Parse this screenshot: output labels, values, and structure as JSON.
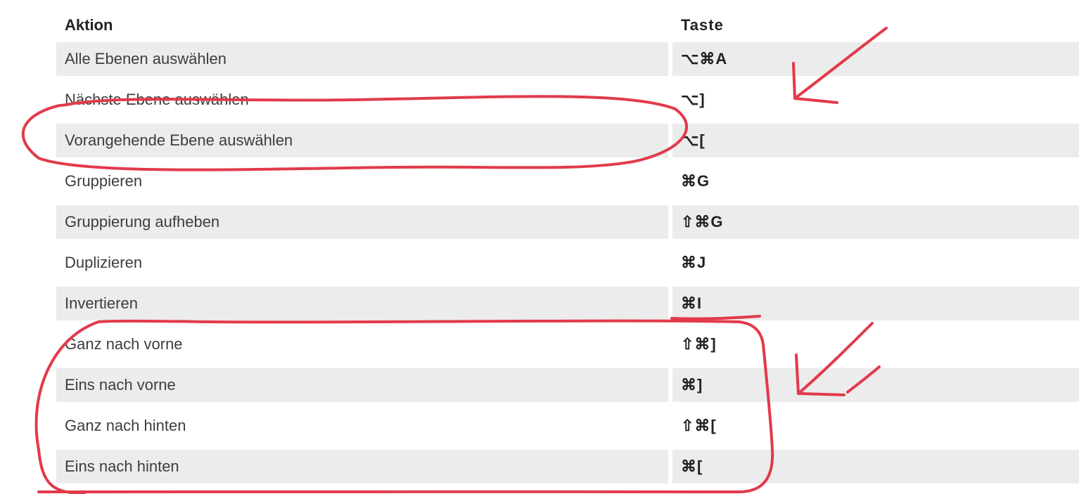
{
  "glyphs": {
    "cmd": "⌘",
    "opt": "⌥",
    "shift": "⇧"
  },
  "headers": {
    "action": "Aktion",
    "key": "Taste"
  },
  "rows": [
    {
      "action": "Alle Ebenen auswählen",
      "key": "⌥⌘A",
      "shade": true
    },
    {
      "action": "Nächste Ebene auswählen",
      "key": "⌥]",
      "shade": false
    },
    {
      "action": "Vorangehende Ebene auswählen",
      "key": "⌥[",
      "shade": true
    },
    {
      "action": "Gruppieren",
      "key": "⌘G",
      "shade": false
    },
    {
      "action": "Gruppierung aufheben",
      "key": "⇧⌘G",
      "shade": true
    },
    {
      "action": "Duplizieren",
      "key": "⌘J",
      "shade": false
    },
    {
      "action": "Invertieren",
      "key": "⌘I",
      "shade": true
    },
    {
      "action": "Ganz nach vorne",
      "key": "⇧⌘]",
      "shade": false
    },
    {
      "action": "Eins nach vorne",
      "key": "⌘]",
      "shade": true
    },
    {
      "action": "Ganz nach hinten",
      "key": "⇧⌘[",
      "shade": false
    },
    {
      "action": "Eins nach hinten",
      "key": "⌘[",
      "shade": true
    }
  ],
  "annotation_color": "#e23a4a"
}
